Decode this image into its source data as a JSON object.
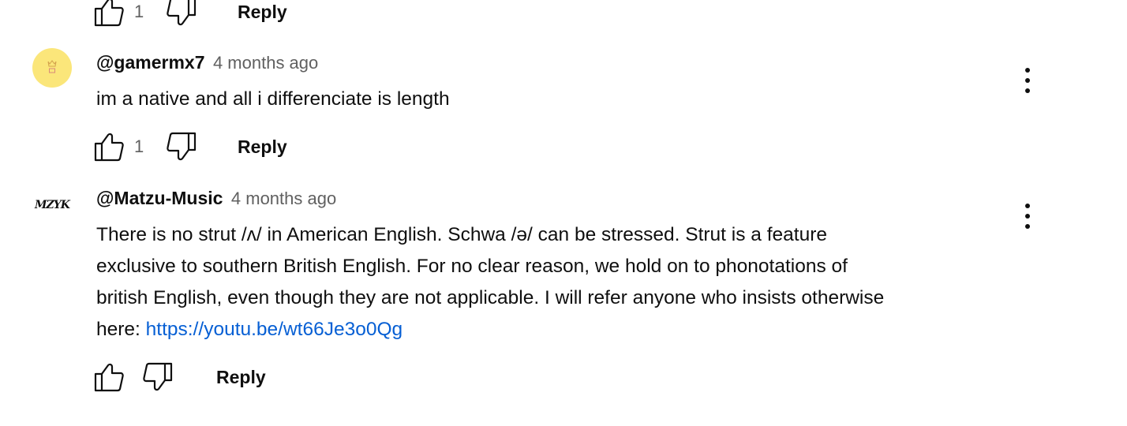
{
  "top_actions": {
    "like_count": "1",
    "reply_label": "Reply"
  },
  "comments": [
    {
      "author": "@gamermx7",
      "timestamp": "4 months ago",
      "text": "im a native and all i differenciate is length",
      "like_count": "1",
      "reply_label": "Reply",
      "avatar_color": "#fbe67a"
    },
    {
      "author": "@Matzu-Music",
      "timestamp": "4 months ago",
      "avatar_logo_text": "MZYK",
      "text_lines": [
        "There is no strut /ʌ/ in American English. Schwa /ə/ can be stressed. Strut is a feature",
        "exclusive to southern British English. For no clear reason, we hold on to phonotations of",
        "british English, even though they are not applicable. I will refer anyone who insists otherwise"
      ],
      "last_line_prefix": "here: ",
      "link": "https://youtu.be/wt66Je3o0Qg",
      "like_count": "",
      "reply_label": "Reply"
    }
  ],
  "icons": {
    "like": "thumbs-up-icon",
    "dislike": "thumbs-down-icon",
    "menu": "more-vert-icon"
  },
  "colors": {
    "link": "#065fd4",
    "secondary_text": "#606060",
    "primary_text": "#0f0f0f"
  }
}
